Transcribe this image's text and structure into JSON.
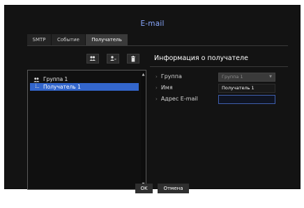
{
  "dialog": {
    "title": "E-mail"
  },
  "tabs": [
    {
      "label": "SMTP",
      "active": false
    },
    {
      "label": "Событие",
      "active": false
    },
    {
      "label": "Получатель",
      "active": true
    }
  ],
  "toolbar": {
    "add_group_icon": "add-group-icon",
    "add_user_icon": "add-user-icon",
    "delete_icon": "trash-icon"
  },
  "tree": {
    "group": {
      "label": "Группа 1",
      "icon": "group-icon"
    },
    "items": [
      {
        "label": "Получатель 1",
        "selected": true
      }
    ]
  },
  "details": {
    "title": "Информация о получателе",
    "fields": {
      "group": {
        "label": "Группа",
        "value": "Группа 1"
      },
      "name": {
        "label": "Имя",
        "value": "Получатель 1"
      },
      "email": {
        "label": "Адрес E-mail",
        "value": ""
      }
    }
  },
  "buttons": {
    "ok": "OK",
    "cancel": "Отмена"
  },
  "colors": {
    "accent": "#3366cc",
    "title": "#8aa9ff",
    "background": "#131313"
  }
}
